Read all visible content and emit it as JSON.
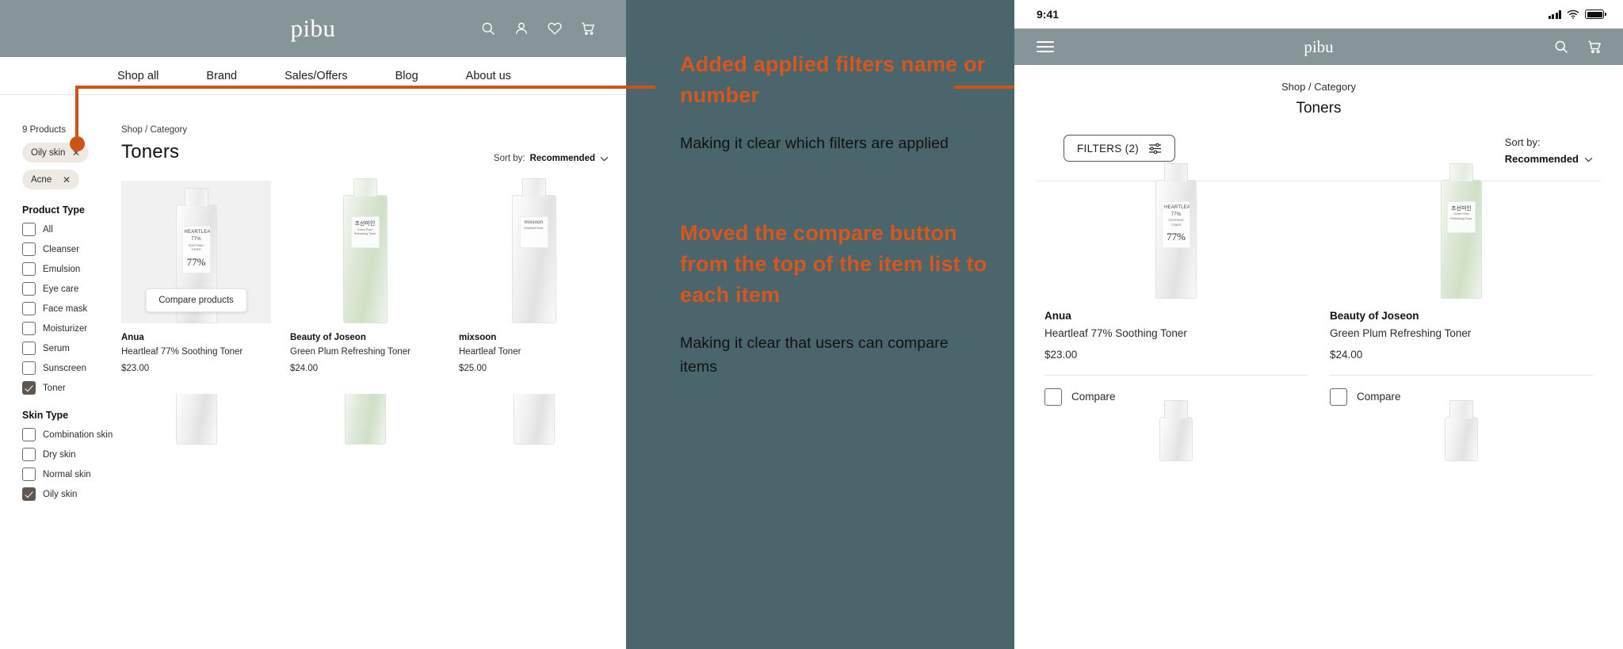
{
  "desktop": {
    "brand": "pibu",
    "header_icons": [
      "search-icon",
      "user-icon",
      "heart-icon",
      "cart-icon"
    ],
    "nav": [
      {
        "label": "Shop all"
      },
      {
        "label": "Brand"
      },
      {
        "label": "Sales/Offers"
      },
      {
        "label": "Blog"
      },
      {
        "label": "About us"
      }
    ],
    "sidebar": {
      "product_count": "9 Products",
      "applied_filters": [
        {
          "label": "Oily skin",
          "remove": "✕"
        },
        {
          "label": "Acne",
          "remove": "✕"
        }
      ],
      "groups": [
        {
          "title": "Product Type",
          "options": [
            {
              "label": "All",
              "checked": false
            },
            {
              "label": "Cleanser",
              "checked": false
            },
            {
              "label": "Emulsion",
              "checked": false
            },
            {
              "label": "Eye care",
              "checked": false
            },
            {
              "label": "Face mask",
              "checked": false
            },
            {
              "label": "Moisturizer",
              "checked": false
            },
            {
              "label": "Serum",
              "checked": false
            },
            {
              "label": "Sunscreen",
              "checked": false
            },
            {
              "label": "Toner",
              "checked": true
            }
          ]
        },
        {
          "title": "Skin Type",
          "options": [
            {
              "label": "Combination skin",
              "checked": false
            },
            {
              "label": "Dry skin",
              "checked": false
            },
            {
              "label": "Normal skin",
              "checked": false
            },
            {
              "label": "Oily skin",
              "checked": true
            }
          ]
        }
      ]
    },
    "main": {
      "breadcrumb": "Shop / Category",
      "category_title": "Toners",
      "sort_label": "Sort by:",
      "sort_value": "Recommended",
      "compare_tooltip": "Compare products",
      "products": [
        {
          "brand": "Anua",
          "name": "Heartleaf 77% Soothing Toner",
          "price": "$23.00",
          "featured": true,
          "bottle_text": "HEARTLEAF 77%",
          "bottle_sub": "SOOTHING TONER",
          "bottle_big": "77%"
        },
        {
          "brand": "Beauty of Joseon",
          "name": "Green Plum Refreshing Toner",
          "price": "$24.00",
          "featured": false,
          "bottle_text": "조선미인",
          "bottle_sub": "Green Plum Refreshing Toner",
          "bottle_big": ""
        },
        {
          "brand": "mixsoon",
          "name": "Heartleaf Toner",
          "price": "$25.00",
          "featured": false,
          "bottle_text": "mixsoon",
          "bottle_sub": "Heartleaf Toner",
          "bottle_big": ""
        }
      ]
    }
  },
  "annotations": {
    "background_color": "#4a656c",
    "accent_color": "#cc5417",
    "blocks": [
      {
        "headline": "Added applied filters name or number",
        "body": "Making it clear which filters are applied"
      },
      {
        "headline": "Moved the compare button from the top of the item list to each item",
        "body": "Making it clear that users can compare items"
      }
    ]
  },
  "mobile": {
    "status_bar": {
      "time": "9:41"
    },
    "brand": "pibu",
    "header_icons": [
      "menu-icon",
      "search-icon",
      "cart-icon"
    ],
    "breadcrumb": "Shop / Category",
    "title": "Toners",
    "filters_button": "FILTERS (2)",
    "sort_label": "Sort by:",
    "sort_value": "Recommended",
    "compare_label": "Compare",
    "products": [
      {
        "brand": "Anua",
        "name": "Heartleaf 77% Soothing Toner",
        "price": "$23.00",
        "bottle_text": "HEARTLEAF 77%",
        "bottle_sub": "SOOTHING TONER",
        "bottle_big": "77%"
      },
      {
        "brand": "Beauty of Joseon",
        "name": "Green Plum Refreshing Toner",
        "price": "$24.00",
        "bottle_text": "조선미인",
        "bottle_sub": "Green Plum Refreshing Toner",
        "bottle_big": ""
      }
    ]
  }
}
